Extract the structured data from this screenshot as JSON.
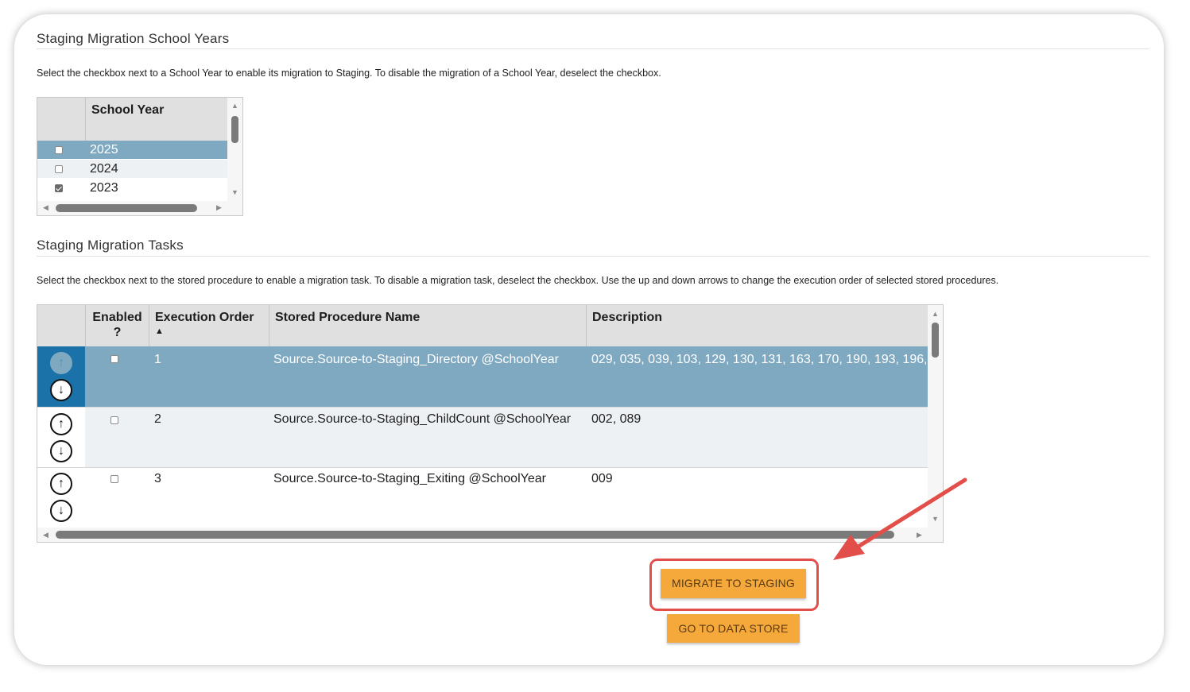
{
  "school_years_section": {
    "title": "Staging Migration School Years",
    "instructions": "Select the checkbox next to a School Year to enable its migration to Staging. To disable the migration of a School Year, deselect the checkbox.",
    "column_header": "School Year",
    "rows": [
      {
        "year": "2025",
        "checked": false,
        "selected": true
      },
      {
        "year": "2024",
        "checked": false,
        "selected": false
      },
      {
        "year": "2023",
        "checked": true,
        "selected": false
      }
    ]
  },
  "tasks_section": {
    "title": "Staging Migration Tasks",
    "instructions": "Select the checkbox next to the stored procedure to enable a migration task. To disable a migration task, deselect the checkbox. Use the up and down arrows to change the execution order of selected stored procedures.",
    "columns": {
      "enabled": "Enabled ?",
      "execution_order": "Execution Order",
      "sort_indicator": "▲",
      "stored_procedure_name": "Stored Procedure Name",
      "description": "Description"
    },
    "rows": [
      {
        "order": "1",
        "name": "Source.Source-to-Staging_Directory @SchoolYear",
        "description": "029, 035, 039, 103, 129, 130, 131, 163, 170, 190, 193, 196,",
        "enabled": false,
        "selected": true
      },
      {
        "order": "2",
        "name": "Source.Source-to-Staging_ChildCount @SchoolYear",
        "description": "002, 089",
        "enabled": false,
        "selected": false
      },
      {
        "order": "3",
        "name": "Source.Source-to-Staging_Exiting @SchoolYear",
        "description": "009",
        "enabled": false,
        "selected": false
      }
    ]
  },
  "buttons": {
    "migrate_label": "MIGRATE TO STAGING",
    "datastore_label": "GO TO DATA STORE"
  },
  "icons": {
    "up": "arrow-up-icon",
    "down": "arrow-down-icon"
  },
  "colors": {
    "selected_row": "#7fa9c1",
    "button_orange": "#f6a93b",
    "annotation_red": "#e24f4a"
  }
}
